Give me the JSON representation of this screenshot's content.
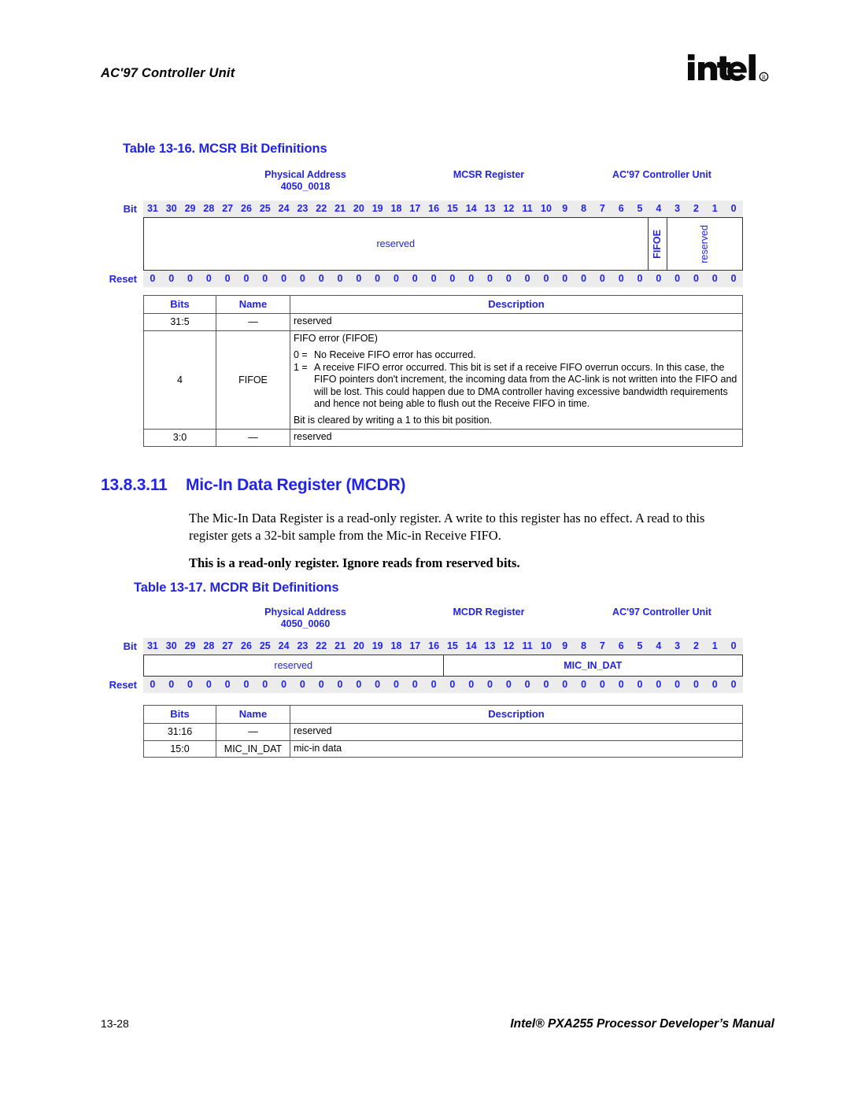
{
  "header": {
    "running_head": "AC'97 Controller Unit",
    "logo_text": "intel",
    "logo_mark": "registered-trademark"
  },
  "footer": {
    "page_number": "13-28",
    "manual_title": "Intel® PXA255 Processor Developer’s Manual"
  },
  "accent_color": "#2323E8",
  "bit_numbers": [
    "31",
    "30",
    "29",
    "28",
    "27",
    "26",
    "25",
    "24",
    "23",
    "22",
    "21",
    "20",
    "19",
    "18",
    "17",
    "16",
    "15",
    "14",
    "13",
    "12",
    "11",
    "10",
    "9",
    "8",
    "7",
    "6",
    "5",
    "4",
    "3",
    "2",
    "1",
    "0"
  ],
  "reset_values": [
    "0",
    "0",
    "0",
    "0",
    "0",
    "0",
    "0",
    "0",
    "0",
    "0",
    "0",
    "0",
    "0",
    "0",
    "0",
    "0",
    "0",
    "0",
    "0",
    "0",
    "0",
    "0",
    "0",
    "0",
    "0",
    "0",
    "0",
    "0",
    "0",
    "0",
    "0",
    "0"
  ],
  "row_labels": {
    "bit": "Bit",
    "reset": "Reset"
  },
  "table_mcsr": {
    "caption": "Table 13-16. MCSR Bit Definitions",
    "physical_address_label": "Physical Address",
    "physical_address_value": "4050_0018",
    "register_name": "MCSR Register",
    "unit_name": "AC'97 Controller Unit",
    "fields": [
      {
        "name": "reserved",
        "span": 27,
        "orientation": "horizontal",
        "bold": false
      },
      {
        "name": "FIFOE",
        "span": 1,
        "orientation": "vertical",
        "bold": true
      },
      {
        "name": "reserved",
        "span": 4,
        "orientation": "vertical",
        "bold": false
      }
    ],
    "columns": {
      "bits": "Bits",
      "name": "Name",
      "description": "Description"
    },
    "rows": [
      {
        "bits": "31:5",
        "name": "—",
        "description_lines": [
          "reserved"
        ],
        "bit_list": []
      },
      {
        "bits": "4",
        "name": "FIFOE",
        "description_lines": [
          "FIFO error (FIFOE)"
        ],
        "bit_list": [
          {
            "key": "0 =",
            "value": "No Receive FIFO error has occurred."
          },
          {
            "key": "1 =",
            "value": "A receive FIFO error occurred. This bit is set if a receive FIFO overrun occurs. In this case, the FIFO pointers don't increment, the incoming data from the AC-link is not written into the FIFO and will be lost. This could happen due to DMA controller having excessive bandwidth requirements and hence not being able to flush out the Receive FIFO in time."
          }
        ],
        "trailing_line": "Bit is cleared by writing a 1 to this bit position."
      },
      {
        "bits": "3:0",
        "name": "—",
        "description_lines": [
          "reserved"
        ],
        "bit_list": []
      }
    ]
  },
  "section": {
    "number": "13.8.3.11",
    "title": "Mic-In Data Register (MCDR)",
    "paragraph": "The Mic-In Data Register is a read-only register. A write to this register has no effect. A read to this register gets a 32-bit sample from the Mic-in Receive FIFO.",
    "note": "This is a read-only register. Ignore reads from reserved bits."
  },
  "table_mcdr": {
    "caption": "Table 13-17. MCDR Bit Definitions",
    "physical_address_label": "Physical Address",
    "physical_address_value": "4050_0060",
    "register_name": "MCDR Register",
    "unit_name": "AC'97 Controller Unit",
    "fields": [
      {
        "name": "reserved",
        "span": 16,
        "orientation": "horizontal",
        "bold": false
      },
      {
        "name": "MIC_IN_DAT",
        "span": 16,
        "orientation": "horizontal",
        "bold": true
      }
    ],
    "columns": {
      "bits": "Bits",
      "name": "Name",
      "description": "Description"
    },
    "rows": [
      {
        "bits": "31:16",
        "name": "—",
        "description_lines": [
          "reserved"
        ],
        "bit_list": []
      },
      {
        "bits": "15:0",
        "name": "MIC_IN_DAT",
        "description_lines": [
          "mic-in data"
        ],
        "bit_list": []
      }
    ]
  }
}
